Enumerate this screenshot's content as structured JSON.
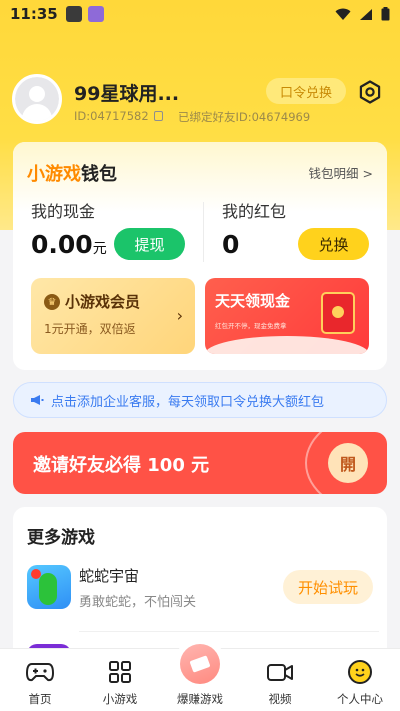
{
  "status_bar": {
    "time": "11:35"
  },
  "profile": {
    "username": "99星球用...",
    "id_text": "ID:04717582",
    "bound_friend": "已绑定好友ID:04674969",
    "redeem_label": "口令兑换"
  },
  "wallet": {
    "title_highlight": "小游戏",
    "title_rest": "钱包",
    "detail_link": "钱包明细 >",
    "cash_label": "我的现金",
    "cash_value": "0.00",
    "cash_unit": "元",
    "withdraw_label": "提现",
    "redpack_label": "我的红包",
    "redpack_value": "0",
    "exchange_label": "兑换",
    "vip_title": "小游戏会员",
    "vip_subtitle": "1元开通，双倍返",
    "cash_card_title": "天天领现金",
    "cash_card_subtitle": "红包开不停，现金免费拿"
  },
  "notice": {
    "text": "点击添加企业客服，每天领取口令兑换大额红包"
  },
  "invite": {
    "text": "邀请好友必得 100 元",
    "button_label": "開"
  },
  "games": {
    "section_title": "更多游戏",
    "items": [
      {
        "name": "蛇蛇宇宙",
        "desc": "勇敢蛇蛇，不怕闯关",
        "button": "开始试玩"
      }
    ]
  },
  "tabbar": {
    "items": [
      {
        "label": "首页",
        "icon": "gamepad-icon"
      },
      {
        "label": "小游戏",
        "icon": "grid-icon"
      },
      {
        "label": "爆赚游戏",
        "icon": "money-icon"
      },
      {
        "label": "视频",
        "icon": "video-icon"
      },
      {
        "label": "个人中心",
        "icon": "smile-icon"
      }
    ],
    "active_index": 4
  },
  "colors": {
    "header_yellow": "#ffd83a",
    "accent_orange": "#ff8a00",
    "withdraw_green": "#1bc46a",
    "invite_red": "#ff5246",
    "notice_blue": "#3a7bf0"
  }
}
